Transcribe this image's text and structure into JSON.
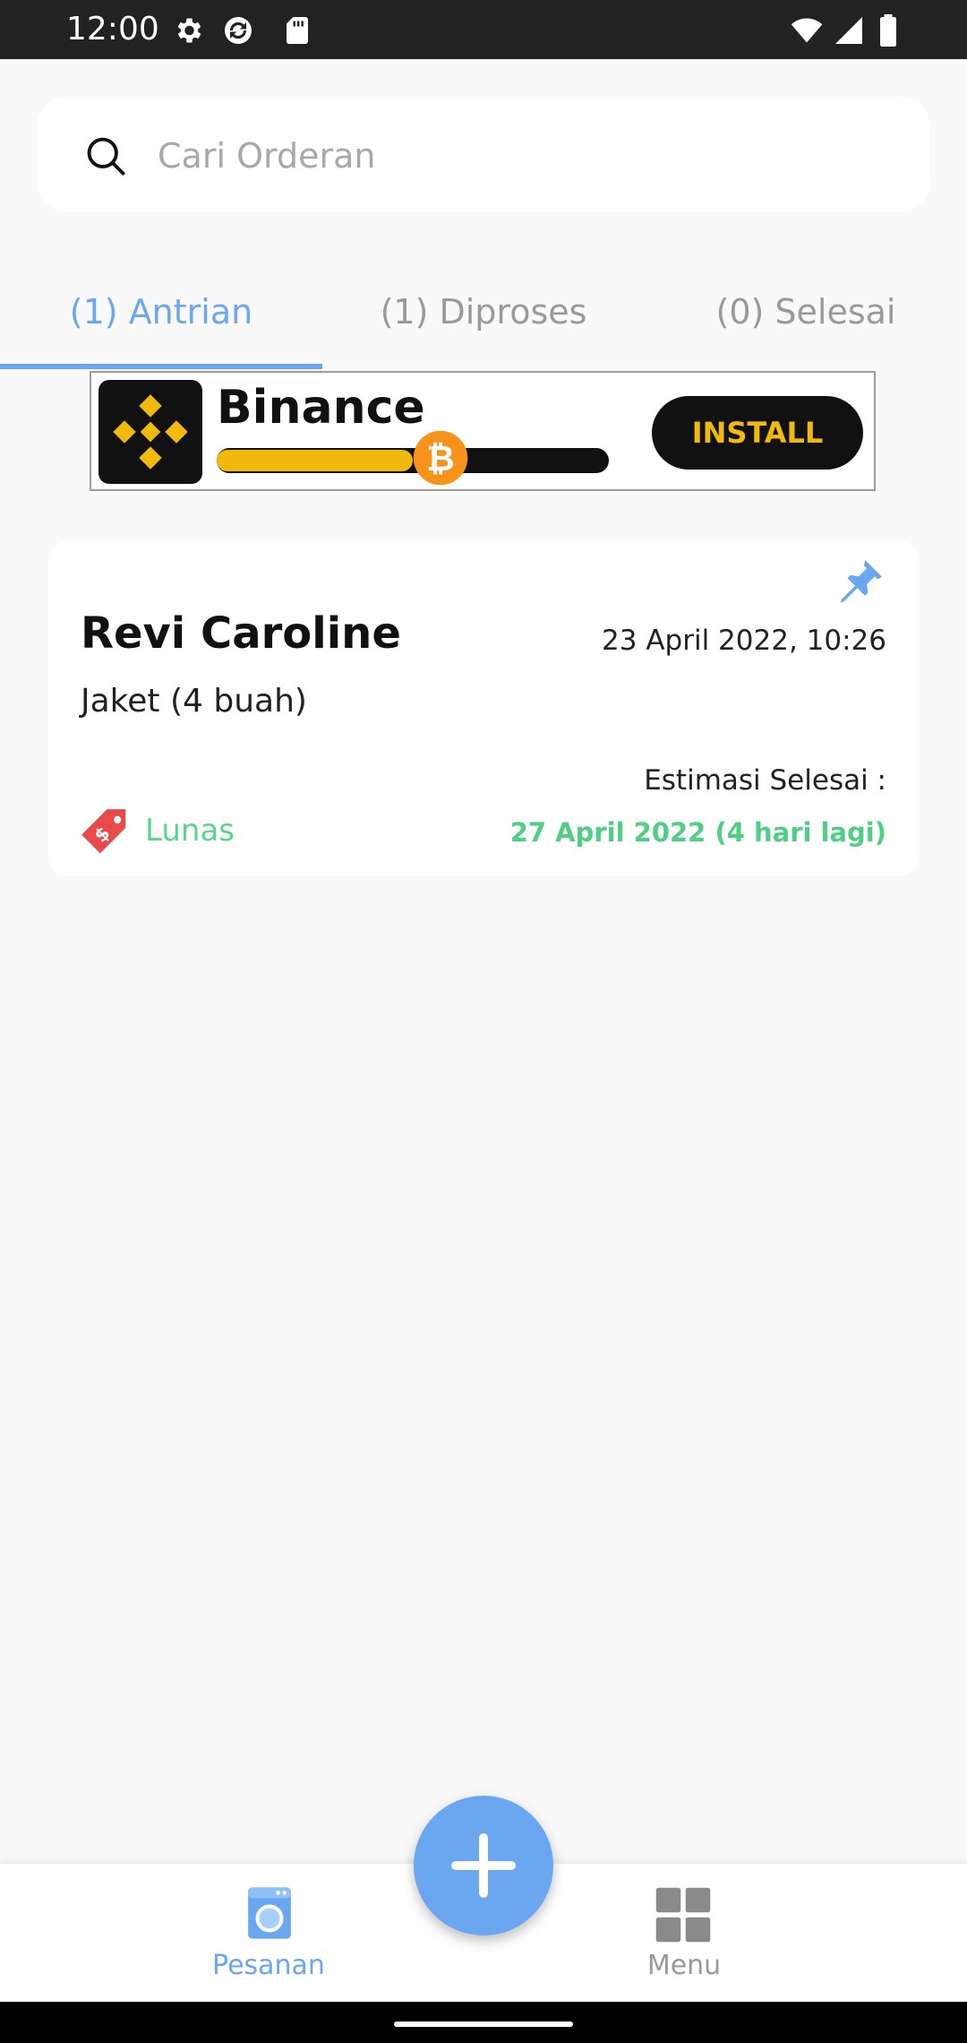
{
  "status_bar": {
    "time": "12:00",
    "left_icons": [
      "gear-icon",
      "sync-icon",
      "sd-card-icon"
    ],
    "right_icons": [
      "wifi-icon",
      "signal-icon",
      "battery-icon"
    ]
  },
  "search": {
    "placeholder": "Cari Orderan",
    "value": ""
  },
  "tabs": [
    {
      "label": "(1) Antrian",
      "active": true
    },
    {
      "label": "(1) Diproses",
      "active": false
    },
    {
      "label": "(0) Selesai",
      "active": false
    }
  ],
  "ad": {
    "title": "Binance",
    "button_label": "INSTALL",
    "progress_fraction": 0.5
  },
  "orders": [
    {
      "customer": "Revi Caroline",
      "date": "23 April 2022, 10:26",
      "items": "Jaket (4 buah)",
      "estimate_label": "Estimasi Selesai :",
      "payment_status": "Lunas",
      "estimate_date": "27 April 2022 (4 hari lagi)",
      "pinned": true
    }
  ],
  "bottom_nav": {
    "items": [
      {
        "label": "Pesanan",
        "icon": "washing-machine-icon",
        "active": true
      },
      {
        "label": "Menu",
        "icon": "grid-icon",
        "active": false
      }
    ],
    "fab_icon": "plus-icon"
  },
  "colors": {
    "accent": "#6aa7f0",
    "success": "#4fcf84",
    "binance_yellow": "#f0b90b",
    "tag_red": "#e84a4a"
  }
}
